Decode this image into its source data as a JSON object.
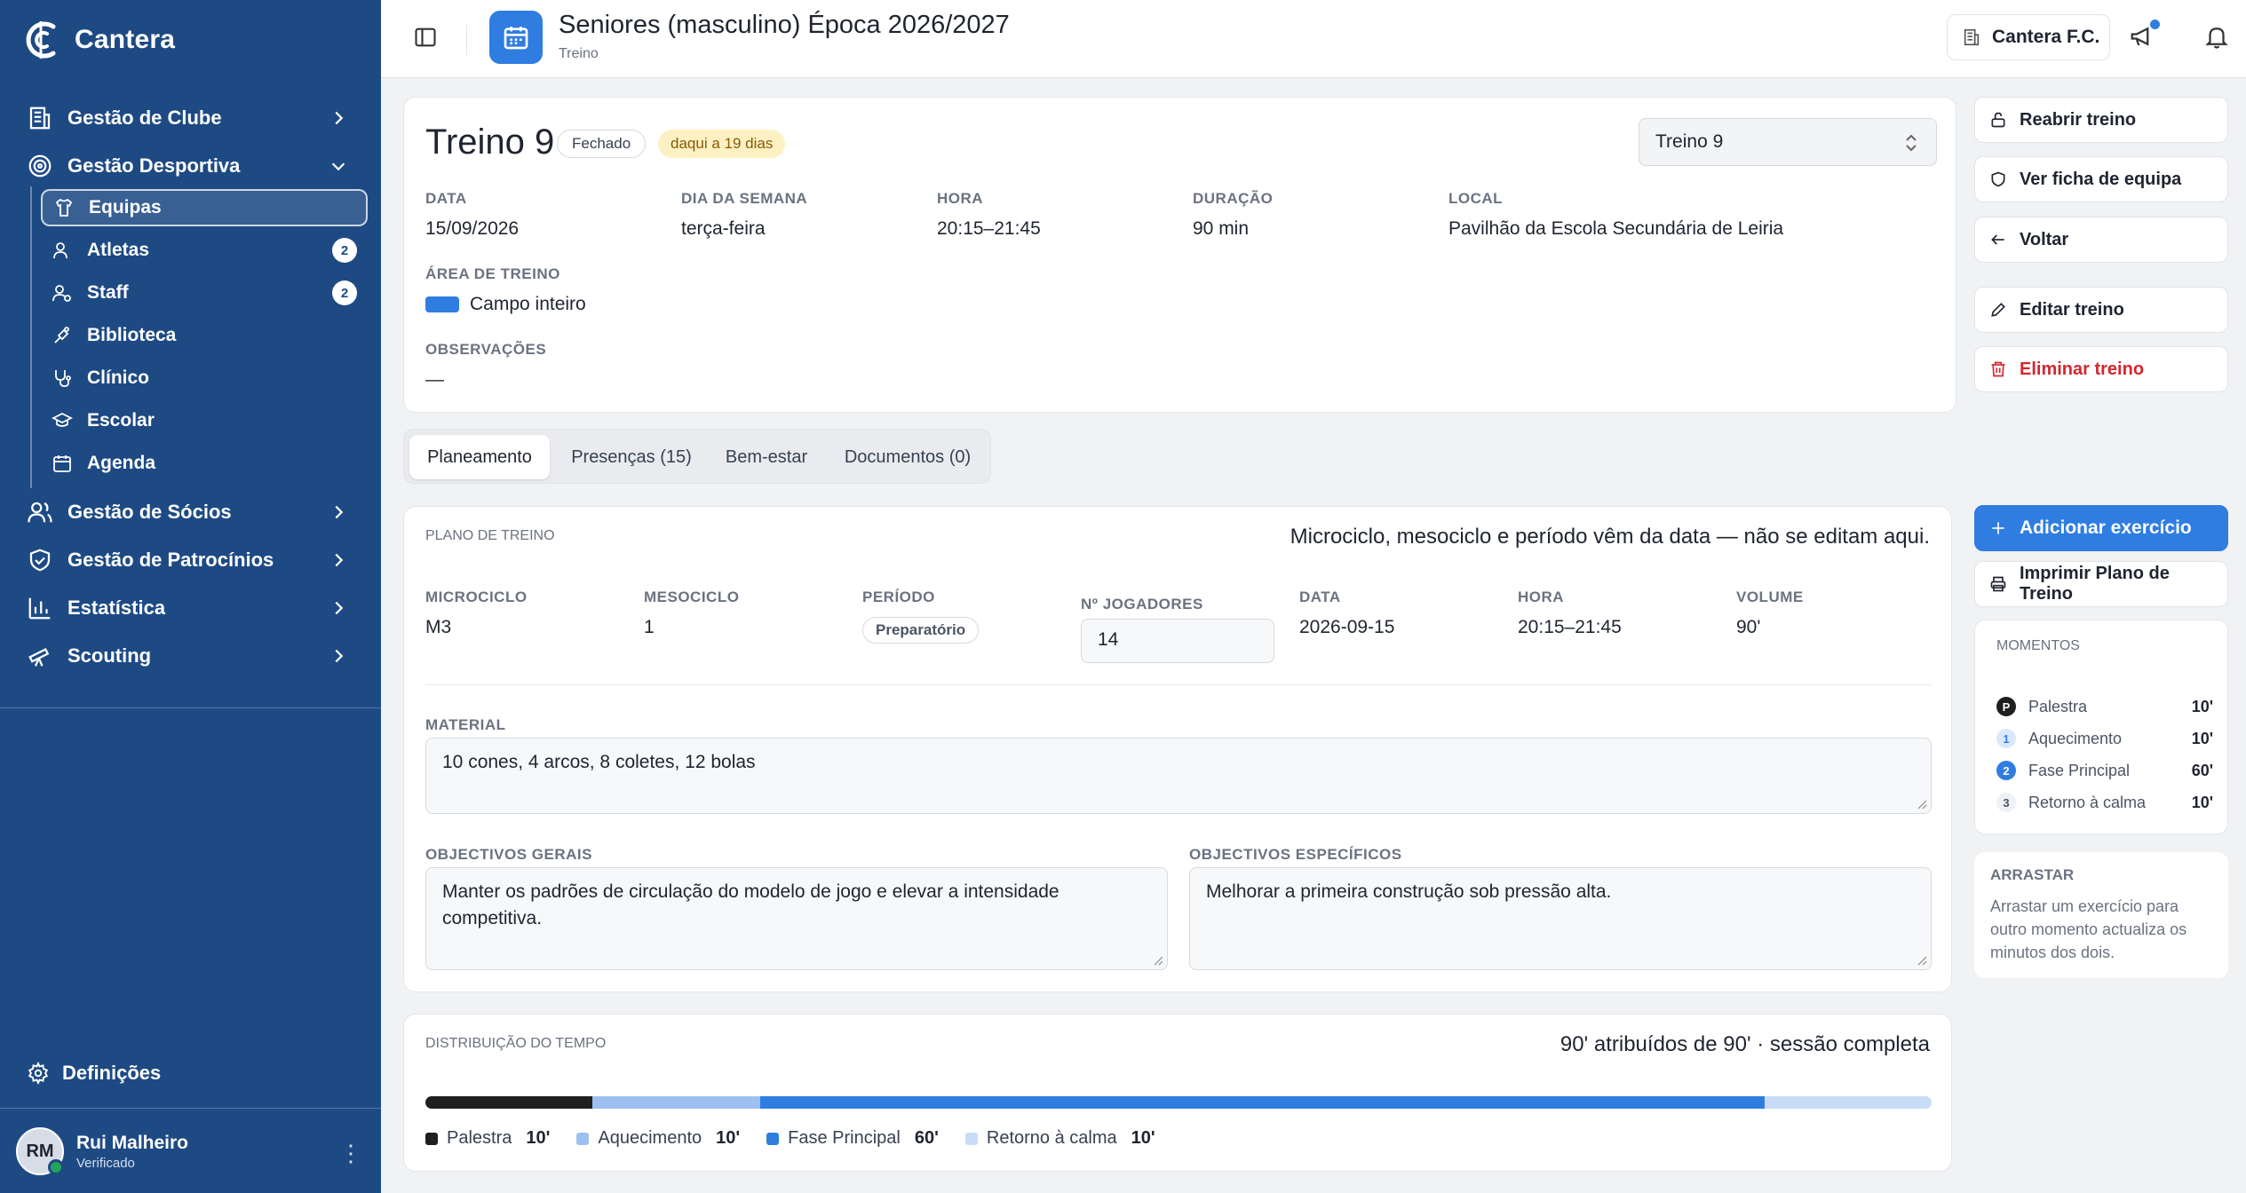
{
  "brand": {
    "name": "Cantera"
  },
  "sidebar": {
    "nav": [
      {
        "label": "Gestão de Clube",
        "icon": "building-icon"
      },
      {
        "label": "Gestão Desportiva",
        "icon": "sport-icon"
      },
      {
        "label": "Gestão de Sócios",
        "icon": "members-icon"
      },
      {
        "label": "Gestão de Patrocínios",
        "icon": "handshake-icon"
      },
      {
        "label": "Estatística",
        "icon": "bar-chart-icon"
      },
      {
        "label": "Scouting",
        "icon": "telescope-icon"
      }
    ],
    "sub": [
      {
        "label": "Equipas",
        "icon": "shirt-icon"
      },
      {
        "label": "Atletas",
        "icon": "athletes-icon",
        "badge": "2"
      },
      {
        "label": "Staff",
        "icon": "staff-icon",
        "badge": "2"
      },
      {
        "label": "Biblioteca",
        "icon": "library-icon"
      },
      {
        "label": "Clínico",
        "icon": "stethoscope-icon"
      },
      {
        "label": "Escolar",
        "icon": "graduation-icon"
      },
      {
        "label": "Agenda",
        "icon": "calendar-icon"
      }
    ],
    "settings": "Definições",
    "user": {
      "initials": "RM",
      "name": "Rui Malheiro",
      "status": "Verificado"
    }
  },
  "header": {
    "title": "Seniores (masculino) Época 2026/2027",
    "subtitle": "Treino",
    "club": "Cantera F.C."
  },
  "training": {
    "title": "Treino 9",
    "status": "Fechado",
    "relative": "daqui a 19 dias",
    "selector": "Treino 9",
    "fields": {
      "date_label": "DATA",
      "date": "15/09/2026",
      "weekday_label": "DIA DA SEMANA",
      "weekday": "terça-feira",
      "time_label": "HORA",
      "time": "20:15–21:45",
      "duration_label": "DURAÇÃO",
      "duration": "90 min",
      "place_label": "LOCAL",
      "place": "Pavilhão da Escola Secundária de Leiria",
      "area_label": "ÁREA DE TREINO",
      "area": "Campo inteiro",
      "area_color": "#2f7de1",
      "notes_label": "OBSERVAÇÕES",
      "notes": "—"
    }
  },
  "actions": {
    "reopen": "Reabrir treino",
    "team_sheet": "Ver ficha de equipa",
    "back": "Voltar",
    "edit": "Editar treino",
    "delete": "Eliminar treino",
    "add_exercise": "Adicionar exercício",
    "print": "Imprimir Plano de Treino"
  },
  "tabs": [
    "Planeamento",
    "Presenças (15)",
    "Bem-estar",
    "Documentos (0)"
  ],
  "plan": {
    "label": "PLANO DE TREINO",
    "note": "Microciclo, mesociclo e período vêm da data — não se editam aqui.",
    "microcycle_label": "MICROCICLO",
    "microcycle": "M3",
    "mesocycle_label": "MESOCICLO",
    "mesocycle": "1",
    "period_label": "PERÍODO",
    "period": "Preparatório",
    "players_label": "Nº JOGADORES",
    "players": "14",
    "date_label": "DATA",
    "date": "2026-09-15",
    "time_label": "HORA",
    "time": "20:15–21:45",
    "volume_label": "VOLUME",
    "volume": "90'",
    "material_label": "MATERIAL",
    "material": "10 cones, 4 arcos, 8 coletes, 12 bolas",
    "general_label": "OBJECTIVOS GERAIS",
    "general": "Manter os padrões de circulação do modelo de jogo e elevar a intensidade competitiva.",
    "specific_label": "OBJECTIVOS ESPECÍFICOS",
    "specific": "Melhorar a primeira construção sob pressão alta."
  },
  "moments": {
    "label": "MOMENTOS",
    "items": [
      {
        "num": "P",
        "name": "Palestra",
        "mins": "10'"
      },
      {
        "num": "1",
        "name": "Aquecimento",
        "mins": "10'"
      },
      {
        "num": "2",
        "name": "Fase Principal",
        "mins": "60'"
      },
      {
        "num": "3",
        "name": "Retorno à calma",
        "mins": "10'"
      }
    ]
  },
  "drag": {
    "label": "ARRASTAR",
    "text": "Arrastar um exercício para outro momento actualiza os minutos dos dois."
  },
  "time": {
    "label": "DISTRIBUIÇÃO DO TEMPO",
    "summary": "90' atribuídos de 90' · sessão completa",
    "segments": [
      {
        "name": "Palestra",
        "mins": 10,
        "label": "10'",
        "color": "#1f1f1f"
      },
      {
        "name": "Aquecimento",
        "mins": 10,
        "label": "10'",
        "color": "#9dc0f0"
      },
      {
        "name": "Fase Principal",
        "mins": 60,
        "label": "60'",
        "color": "#2f7de1"
      },
      {
        "name": "Retorno à calma",
        "mins": 10,
        "label": "10'",
        "color": "#c9dcf6"
      }
    ]
  }
}
